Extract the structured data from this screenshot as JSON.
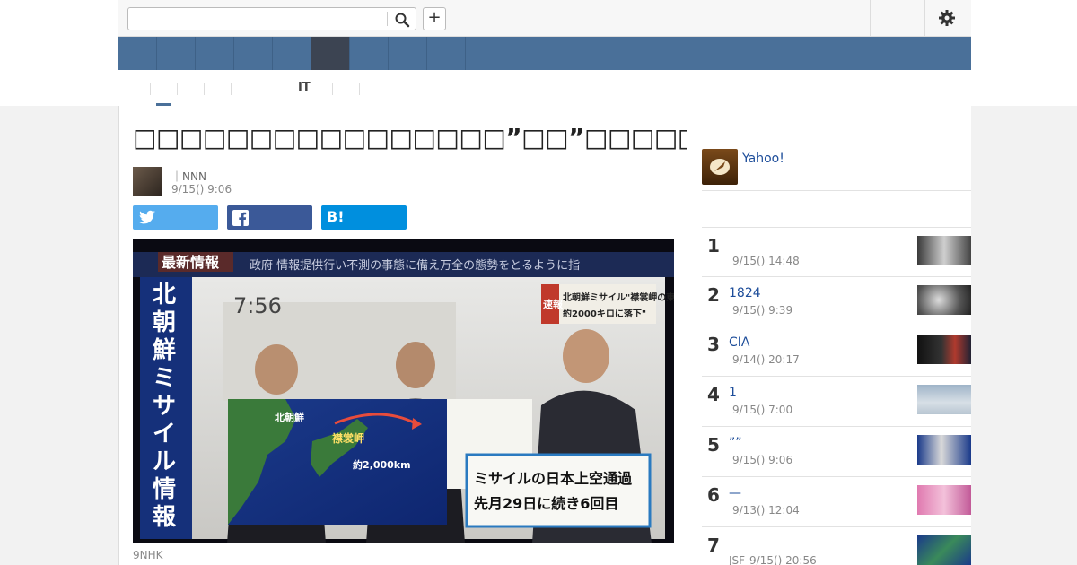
{
  "header": {
    "search": {
      "value": "",
      "placeholder": ""
    },
    "add_label": "+"
  },
  "subnav": {
    "it_label": "IT"
  },
  "article": {
    "title": "□□□□□□□□□□□□□□□□”□□”□□□□□□□□□□□□□□",
    "byline": "｜NNN",
    "date": "9/15() 9:06",
    "share": {
      "hatena_label": "B!"
    },
    "photo_overlays": {
      "banner": "最新情報",
      "ticker": "政府  情報提供行い不測の事態に備え万全の態勢をとるように指",
      "clock": "7:56",
      "vertical": [
        "北",
        "朝",
        "鮮",
        "ミ",
        "サ",
        "イ",
        "ル",
        "情",
        "報"
      ],
      "flash_tag": "速報",
      "flash_text": [
        "北朝鮮ミサイル\"襟裳岬の東",
        "約2000キロに落下\""
      ],
      "map_country": "北朝鮮",
      "map_cape": "襟裳岬",
      "map_distance": "約2,000km",
      "board": [
        "ミサイルの日本上空通過",
        "先月29日に続き6回目"
      ]
    },
    "caption": "9NHK"
  },
  "sidebar": {
    "yahoo_label": "Yahoo!",
    "ranking": [
      {
        "num": "1",
        "title": "",
        "date": "9/15() 14:48",
        "source": ""
      },
      {
        "num": "2",
        "title": "1824",
        "date": "9/15() 9:39",
        "source": ""
      },
      {
        "num": "3",
        "title": "CIA",
        "date": "9/14() 20:17",
        "source": ""
      },
      {
        "num": "4",
        "title": "1",
        "date": "9/15() 7:00",
        "source": ""
      },
      {
        "num": "5",
        "title": "””",
        "date": "9/15() 9:06",
        "source": ""
      },
      {
        "num": "6",
        "title": "—",
        "date": "9/13() 12:04",
        "source": ""
      },
      {
        "num": "7",
        "title": "",
        "date": "9/15() 20:56",
        "source": "JSF"
      }
    ]
  },
  "colors": {
    "nav": "#4a7099",
    "nav_active": "#3c4452",
    "link": "#1d4d9a",
    "twitter": "#55acee",
    "facebook": "#3b5998",
    "hatena": "#008fde"
  }
}
